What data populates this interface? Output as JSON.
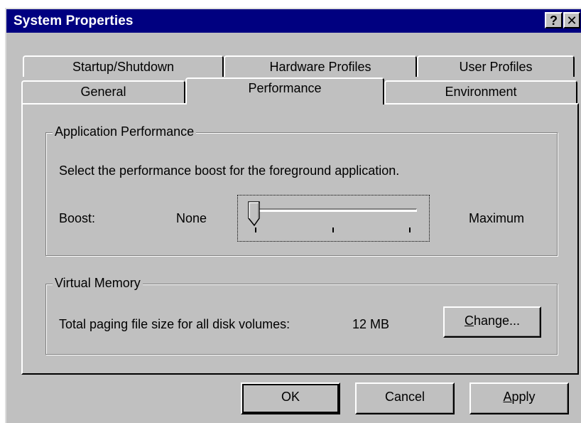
{
  "window": {
    "title": "System Properties",
    "help_button": "?",
    "close_button": "✕"
  },
  "tabs": {
    "back_row": [
      "Startup/Shutdown",
      "Hardware Profiles",
      "User Profiles"
    ],
    "front_row": [
      "General",
      "Performance",
      "Environment"
    ],
    "selected": "Performance"
  },
  "application_performance": {
    "group_label": "Application Performance",
    "description": "Select the performance boost for the foreground application.",
    "boost_label": "Boost:",
    "min_label": "None",
    "max_label": "Maximum",
    "slider_value": 0,
    "slider_steps": 3
  },
  "virtual_memory": {
    "group_label": "Virtual Memory",
    "description": "Total paging file size for all disk volumes:",
    "size_value": "12 MB",
    "change_button_mnemonic": "C",
    "change_button_rest": "hange..."
  },
  "buttons": {
    "ok": "OK",
    "cancel": "Cancel",
    "apply_mnemonic": "A",
    "apply_rest": "pply"
  }
}
